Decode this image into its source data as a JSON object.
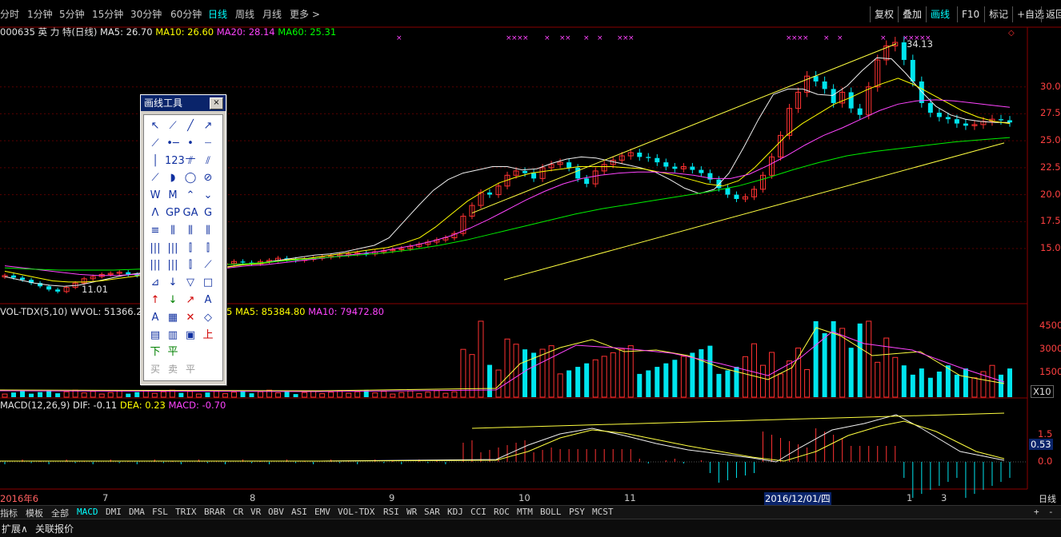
{
  "toolbar": {
    "periods": [
      "分时",
      "1分钟",
      "5分钟",
      "15分钟",
      "30分钟",
      "60分钟",
      "日线",
      "周线",
      "月线",
      "更多 >"
    ],
    "active_period": "日线",
    "right_buttons": [
      "复权",
      "叠加",
      "画线",
      "F10",
      "标记",
      "+自选",
      "返回"
    ],
    "active_right": "画线"
  },
  "price_legend": {
    "stock": "000635 英 力 特(日线)",
    "ma5": "MA5: 26.70",
    "ma10": "MA10: 26.60",
    "ma20": "MA20: 28.14",
    "ma60": "MA60: 25.31"
  },
  "vol_legend": {
    "name": "VOL-TDX(5,10)",
    "wvol": "WVOL: 51366.25",
    "ma5": "MA5: 85384.80",
    "ma10": "MA10: 79472.80",
    "partial": "5"
  },
  "macd_legend": {
    "name": "MACD(12,26,9)",
    "dif": "DIF: -0.11",
    "dea": "DEA: 0.23",
    "macd": "MACD: -0.70"
  },
  "price_axis": [
    "30.0",
    "27.5",
    "25.0",
    "22.5",
    "20.0",
    "17.5",
    "15.0"
  ],
  "vol_axis": [
    "4500",
    "3000",
    "1500"
  ],
  "vol_unit": "X10",
  "macd_axis": [
    "1.5",
    "0.53",
    "0.0"
  ],
  "annotations": {
    "high": "34.13",
    "low": "11.01"
  },
  "date_labels": [
    "2016年6",
    "7",
    "8",
    "9",
    "10",
    "11",
    "2016/12/01/四",
    "1",
    "3"
  ],
  "indicator_tabs": [
    "指标",
    "模板",
    "全部",
    "MACD",
    "DMI",
    "DMA",
    "FSL",
    "TRIX",
    "BRAR",
    "CR",
    "VR",
    "OBV",
    "ASI",
    "EMV",
    "VOL-TDX",
    "RSI",
    "WR",
    "SAR",
    "KDJ",
    "CCI",
    "ROC",
    "MTM",
    "BOLL",
    "PSY",
    "MCST"
  ],
  "active_indicator": "MACD",
  "bottom_right": {
    "period": "日线",
    "plus": "+",
    "minus": "-"
  },
  "footer": {
    "expand": "扩展∧",
    "related": "关联报价"
  },
  "draw_tool": {
    "title": "画线工具",
    "close": "×",
    "icons": [
      "pointer",
      "line-segment",
      "line",
      "ray",
      "straight-line",
      "horizontal-line",
      "horizontal-ray",
      "dotted-line",
      "vertical-line",
      "price-label",
      "parallel-lines",
      "parallel-ray",
      "arc-line",
      "arc",
      "circle",
      "circle-spiral",
      "wave-w",
      "wave-m",
      "wave-up",
      "wave-down",
      "wave-dip",
      "golden-ratio",
      "gold-arc",
      "gann-line",
      "fibonacci-line",
      "fibonacci-fan",
      "fibonacci-speed",
      "fibonacci-rays",
      "cycle-lines",
      "time-cycle",
      "vertical-fibonacci",
      "percent-line",
      "multi-lines",
      "period-lines",
      "grid-lines",
      "gann-fan",
      "angle-fan",
      "down-arrow-line",
      "triangle",
      "rectangle",
      "up-arrow",
      "down-arrow",
      "up-pointer",
      "text",
      "text-tool",
      "stamp",
      "delete",
      "clear",
      "note",
      "box-text",
      "board",
      "up-mark",
      "down-mark",
      "flat-mark"
    ],
    "trade_labels": [
      "买",
      "卖",
      "平"
    ]
  },
  "chart_data": {
    "type": "candlestick",
    "title": "000635 英力特(日线)",
    "price_range": [
      11,
      34.5
    ],
    "months": [
      "2016年6",
      "7",
      "8",
      "9",
      "10",
      "11",
      "12",
      "1",
      "3"
    ],
    "key_points": {
      "low": 11.01,
      "high": 34.13,
      "last_close": 26.7
    },
    "price_path": [
      12.5,
      12.3,
      12.1,
      11.8,
      11.5,
      11.2,
      11.01,
      11.4,
      11.8,
      12.2,
      12.4,
      12.6,
      12.7,
      12.8,
      12.6,
      12.5,
      12.7,
      12.9,
      13.0,
      13.1,
      13.0,
      13.2,
      13.4,
      13.3,
      13.5,
      13.6,
      13.8,
      13.7,
      13.6,
      13.8,
      13.9,
      14.1,
      14.0,
      13.9,
      14.0,
      14.1,
      14.2,
      14.3,
      14.4,
      14.5,
      14.6,
      14.5,
      14.7,
      14.8,
      14.9,
      15.0,
      15.2,
      15.4,
      15.6,
      15.8,
      16.0,
      16.4,
      18.0,
      19.0,
      20.2,
      20.0,
      20.8,
      21.8,
      22.2,
      22.0,
      21.5,
      22.5,
      22.8,
      23.0,
      22.5,
      21.5,
      21.0,
      22.2,
      22.8,
      23.2,
      23.6,
      23.9,
      23.5,
      23.4,
      23.0,
      22.6,
      22.4,
      22.6,
      22.3,
      22.0,
      21.4,
      20.6,
      20.0,
      19.6,
      19.8,
      20.5,
      21.8,
      23.5,
      25.5,
      28.0,
      29.5,
      31.0,
      30.5,
      29.8,
      28.5,
      29.5,
      28.0,
      27.4,
      30.0,
      32.5,
      33.8,
      34.13,
      32.5,
      30.5,
      28.5,
      27.6,
      27.2,
      27.0,
      26.6,
      26.4,
      26.5,
      26.8,
      27.0,
      26.9,
      26.7
    ],
    "ma5": [
      12.4,
      12.1,
      11.8,
      11.6,
      11.5,
      11.6,
      11.9,
      12.2,
      12.5,
      12.7,
      12.8,
      12.9,
      13.0,
      13.1,
      13.2,
      13.3,
      13.5,
      13.6,
      13.8,
      14.0,
      14.2,
      14.4,
      14.5,
      14.7,
      15.0,
      15.3,
      16.0,
      17.5,
      19.0,
      20.4,
      21.4,
      22.0,
      22.3,
      22.6,
      22.6,
      22.3,
      22.4,
      22.9,
      23.3,
      23.5,
      23.4,
      23.1,
      22.8,
      22.5,
      22.1,
      21.4,
      20.6,
      20.1,
      20.5,
      22.0,
      24.4,
      27.0,
      29.3,
      29.8,
      29.8,
      29.3,
      29.2,
      30.1,
      31.5,
      32.7,
      32.6,
      31.2,
      29.6,
      28.2,
      27.4,
      27.0,
      26.8,
      26.7,
      26.7
    ],
    "ma10": [
      12.9,
      12.6,
      12.3,
      12.0,
      11.9,
      11.9,
      12.0,
      12.2,
      12.4,
      12.6,
      12.8,
      12.9,
      13.0,
      13.2,
      13.3,
      13.5,
      13.6,
      13.8,
      14.0,
      14.1,
      14.3,
      14.5,
      14.7,
      14.9,
      15.1,
      15.5,
      16.0,
      17.0,
      18.2,
      19.4,
      20.3,
      21.1,
      21.6,
      22.0,
      22.2,
      22.4,
      22.6,
      22.6,
      22.6,
      22.5,
      22.4,
      22.1,
      21.8,
      21.4,
      21.0,
      20.8,
      21.3,
      22.5,
      24.0,
      25.5,
      26.6,
      27.5,
      28.4,
      29.0,
      29.7,
      30.3,
      30.8,
      30.2,
      29.4,
      28.6,
      27.8,
      27.2,
      26.8,
      26.6
    ],
    "ma20": [
      13.4,
      13.2,
      13.0,
      12.8,
      12.6,
      12.5,
      12.5,
      12.6,
      12.7,
      12.8,
      12.9,
      13.1,
      13.2,
      13.4,
      13.5,
      13.7,
      13.9,
      14.1,
      14.3,
      14.5,
      14.7,
      15.0,
      15.3,
      15.7,
      16.2,
      16.9,
      17.7,
      18.6,
      19.5,
      20.3,
      21.0,
      21.5,
      21.8,
      22.0,
      22.1,
      22.1,
      22.0,
      21.8,
      21.5,
      21.5,
      21.9,
      22.7,
      23.6,
      24.6,
      25.5,
      26.2,
      27.0,
      27.8,
      28.4,
      28.7,
      28.8,
      28.7,
      28.5,
      28.3,
      28.1
    ],
    "ma60": [
      13.2,
      13.1,
      13.0,
      13.0,
      13.0,
      13.1,
      13.2,
      13.3,
      13.5,
      13.6,
      13.8,
      14.0,
      14.2,
      14.4,
      14.6,
      14.9,
      15.3,
      15.8,
      16.4,
      17.0,
      17.6,
      18.2,
      18.7,
      19.1,
      19.5,
      19.9,
      20.3,
      20.8,
      21.5,
      22.3,
      23.0,
      23.6,
      24.0,
      24.3,
      24.6,
      24.9,
      25.1,
      25.3
    ],
    "trendlines": [
      [
        [
          "1",
          "19.0"
        ],
        [
          "1",
          "34.0"
        ]
      ]
    ],
    "macd": {
      "dif_last": -0.11,
      "dea_last": 0.23,
      "macd_last": -0.7
    }
  }
}
